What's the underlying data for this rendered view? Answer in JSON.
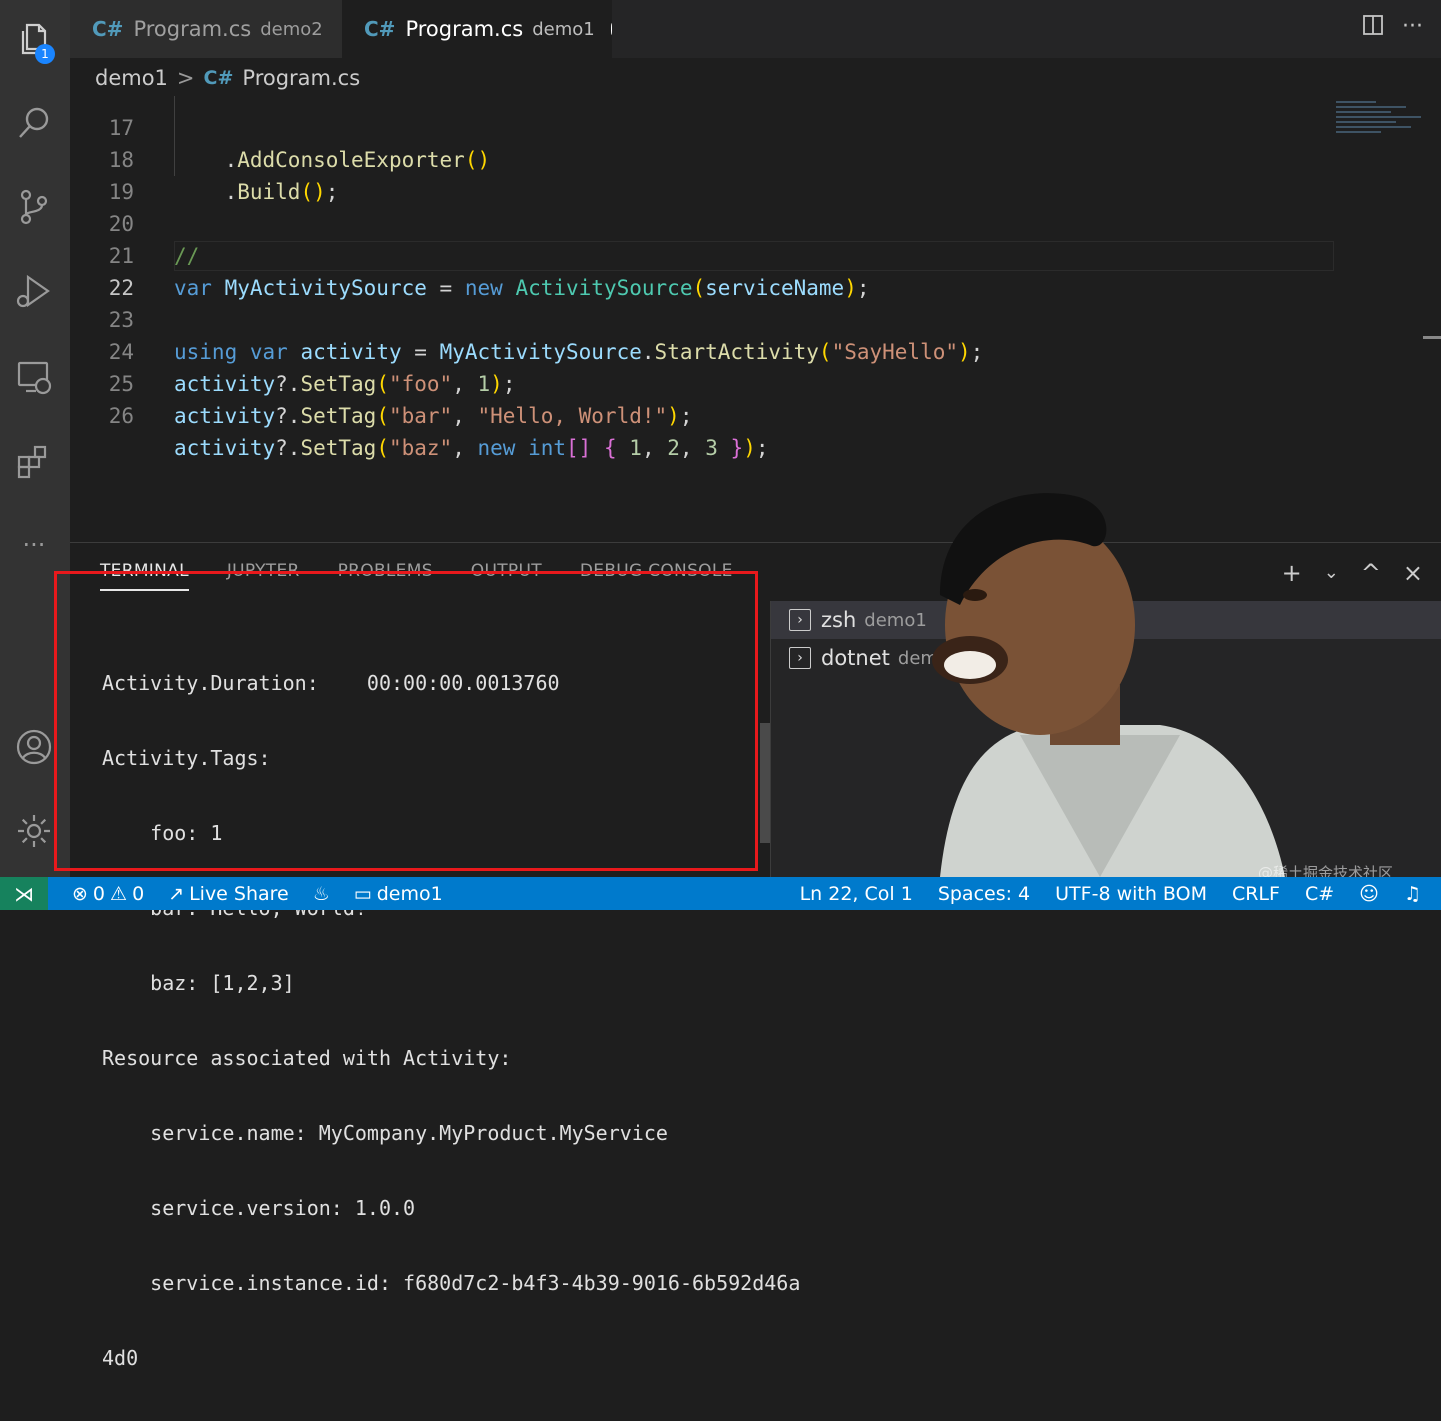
{
  "tabs": [
    {
      "label": "Program.cs",
      "description": "demo2",
      "dirty": false
    },
    {
      "label": "Program.cs",
      "description": "demo1",
      "dirty": true
    }
  ],
  "tab_icon": "C#",
  "activity_bar": {
    "explorer_badge": "1",
    "icons": [
      "explorer-icon",
      "search-icon",
      "source-control-icon",
      "run-debug-icon",
      "remote-explorer-icon",
      "extensions-icon",
      "more-icon",
      "account-icon",
      "manage-gear-icon"
    ]
  },
  "breadcrumb": {
    "folder": "demo1",
    "file": "Program.cs",
    "separator": ">"
  },
  "editor": {
    "current_line": 22,
    "lines": [
      {
        "num": "17",
        "text": "    .AddConsoleExporter()"
      },
      {
        "num": "18",
        "text": "    .Build();"
      },
      {
        "num": "19",
        "text": ""
      },
      {
        "num": "20",
        "text": "//"
      },
      {
        "num": "21",
        "text": "var MyActivitySource = new ActivitySource(serviceName);"
      },
      {
        "num": "22",
        "text": ""
      },
      {
        "num": "23",
        "text": "using var activity = MyActivitySource.StartActivity(\"SayHello\");"
      },
      {
        "num": "24",
        "text": "activity?.SetTag(\"foo\", 1);"
      },
      {
        "num": "25",
        "text": "activity?.SetTag(\"bar\", \"Hello, World!\");"
      },
      {
        "num": "26",
        "text": "activity?.SetTag(\"baz\", new int[] { 1, 2, 3 });"
      }
    ]
  },
  "panel": {
    "tabs": [
      "TERMINAL",
      "JUPYTER",
      "PROBLEMS",
      "OUTPUT",
      "DEBUG CONSOLE"
    ],
    "active_tab": "TERMINAL",
    "terminal_lines": [
      "Activity.Duration:    00:00:00.0013760",
      "Activity.Tags:",
      "    foo: 1",
      "    bar: Hello, World!",
      "    baz: [1,2,3]",
      "Resource associated with Activity:",
      "    service.name: MyCompany.MyProduct.MyService",
      "    service.version: 1.0.0",
      "    service.instance.id: f680d7c2-b4f3-4b39-9016-6b592d46a",
      "4d0"
    ],
    "terminals": [
      {
        "name": "zsh",
        "desc": "demo1"
      },
      {
        "name": "dotnet",
        "desc": "demo1"
      }
    ],
    "actions": {
      "new": "+",
      "dropdown": "⌄",
      "maximize": "^",
      "close": "×"
    }
  },
  "status_bar": {
    "errors": "0",
    "warnings": "0",
    "live_share": "Live Share",
    "folder": "demo1",
    "position": "Ln 22, Col 1",
    "spaces": "Spaces: 4",
    "encoding": "UTF-8 with BOM",
    "eol": "CRLF",
    "language": "C#"
  },
  "watermark": "@稀土掘金技术社区",
  "colors": {
    "accent": "#007acc",
    "remote": "#16825d",
    "highlight": "#e8191c"
  }
}
